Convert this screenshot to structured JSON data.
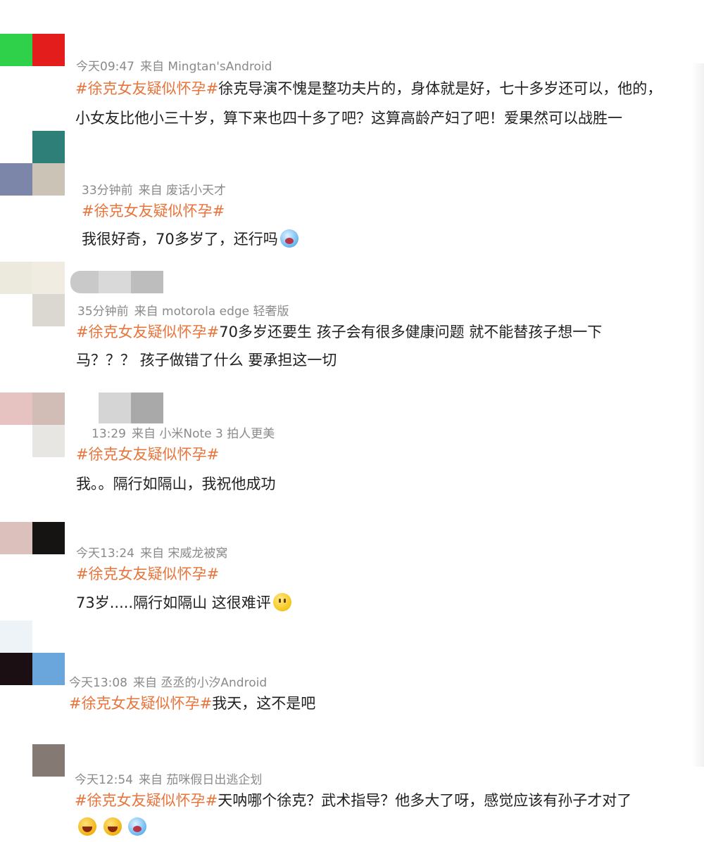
{
  "theme": {
    "hashtag_color": "#e8743b",
    "meta_color": "#8a8a8a",
    "text_color": "#1f1f1f"
  },
  "hashtag": "#徐克女友疑似怀孕#",
  "comments": [
    {
      "time": "今天09:47",
      "source": "来自 Mingtan'sAndroid",
      "lines": [
        "徐克导演不愧是整功夫片的，身体就是好，七十多岁还可以，他的，",
        "小女友比他小三十岁，算下来也四十多了吧？这算高龄产妇了吧！爱果然可以战胜一"
      ]
    },
    {
      "time": "33分钟前",
      "source": "来自 废话小天才",
      "lines": [
        "",
        "我很好奇，70多岁了，还行吗"
      ],
      "emoji": "cry-icon"
    },
    {
      "time": "35分钟前",
      "source": "来自 motorola edge 轻奢版",
      "lines": [
        "70多岁还要生 孩子会有很多健康问题 就不能替孩子想一下",
        "马？？？ 孩子做错了什么 要承担这一切"
      ]
    },
    {
      "time": "13:29",
      "source": "来自 小米Note 3 拍人更美",
      "lines": [
        "",
        "我。。隔行如隔山，我祝他成功"
      ]
    },
    {
      "time": "今天13:24",
      "source": "来自 宋威龙被窝",
      "lines": [
        "",
        "73岁.....隔行如隔山 这很难评"
      ],
      "emoji": "smile-icon"
    },
    {
      "time": "今天13:08",
      "source": "来自 丞丞的小汐Android",
      "lines": [
        "我天，这不是吧"
      ]
    },
    {
      "time": "今天12:54",
      "source": "来自 茄咪假日出逃企划",
      "lines": [
        "天呐哪个徐克？武术指导？他多大了呀，感觉应该有孙子才对了"
      ],
      "emojis": [
        "laugh-icon",
        "laugh-icon",
        "laugh-cry-icon"
      ]
    }
  ]
}
